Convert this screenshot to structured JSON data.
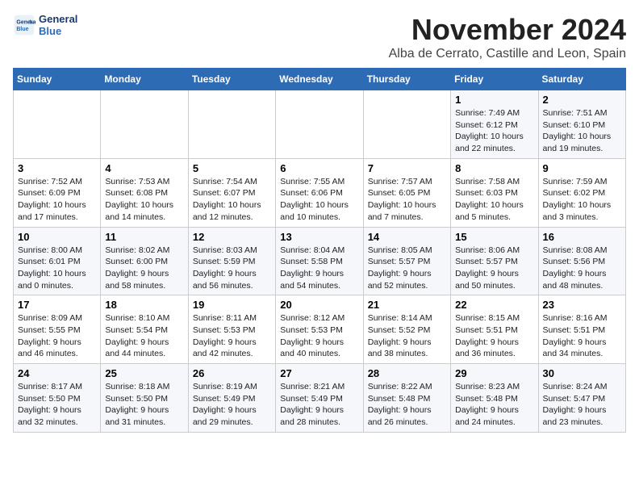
{
  "logo": {
    "line1": "General",
    "line2": "Blue"
  },
  "title": "November 2024",
  "location": "Alba de Cerrato, Castille and Leon, Spain",
  "weekdays": [
    "Sunday",
    "Monday",
    "Tuesday",
    "Wednesday",
    "Thursday",
    "Friday",
    "Saturday"
  ],
  "weeks": [
    [
      {
        "day": "",
        "text": ""
      },
      {
        "day": "",
        "text": ""
      },
      {
        "day": "",
        "text": ""
      },
      {
        "day": "",
        "text": ""
      },
      {
        "day": "",
        "text": ""
      },
      {
        "day": "1",
        "text": "Sunrise: 7:49 AM\nSunset: 6:12 PM\nDaylight: 10 hours and 22 minutes."
      },
      {
        "day": "2",
        "text": "Sunrise: 7:51 AM\nSunset: 6:10 PM\nDaylight: 10 hours and 19 minutes."
      }
    ],
    [
      {
        "day": "3",
        "text": "Sunrise: 7:52 AM\nSunset: 6:09 PM\nDaylight: 10 hours and 17 minutes."
      },
      {
        "day": "4",
        "text": "Sunrise: 7:53 AM\nSunset: 6:08 PM\nDaylight: 10 hours and 14 minutes."
      },
      {
        "day": "5",
        "text": "Sunrise: 7:54 AM\nSunset: 6:07 PM\nDaylight: 10 hours and 12 minutes."
      },
      {
        "day": "6",
        "text": "Sunrise: 7:55 AM\nSunset: 6:06 PM\nDaylight: 10 hours and 10 minutes."
      },
      {
        "day": "7",
        "text": "Sunrise: 7:57 AM\nSunset: 6:05 PM\nDaylight: 10 hours and 7 minutes."
      },
      {
        "day": "8",
        "text": "Sunrise: 7:58 AM\nSunset: 6:03 PM\nDaylight: 10 hours and 5 minutes."
      },
      {
        "day": "9",
        "text": "Sunrise: 7:59 AM\nSunset: 6:02 PM\nDaylight: 10 hours and 3 minutes."
      }
    ],
    [
      {
        "day": "10",
        "text": "Sunrise: 8:00 AM\nSunset: 6:01 PM\nDaylight: 10 hours and 0 minutes."
      },
      {
        "day": "11",
        "text": "Sunrise: 8:02 AM\nSunset: 6:00 PM\nDaylight: 9 hours and 58 minutes."
      },
      {
        "day": "12",
        "text": "Sunrise: 8:03 AM\nSunset: 5:59 PM\nDaylight: 9 hours and 56 minutes."
      },
      {
        "day": "13",
        "text": "Sunrise: 8:04 AM\nSunset: 5:58 PM\nDaylight: 9 hours and 54 minutes."
      },
      {
        "day": "14",
        "text": "Sunrise: 8:05 AM\nSunset: 5:57 PM\nDaylight: 9 hours and 52 minutes."
      },
      {
        "day": "15",
        "text": "Sunrise: 8:06 AM\nSunset: 5:57 PM\nDaylight: 9 hours and 50 minutes."
      },
      {
        "day": "16",
        "text": "Sunrise: 8:08 AM\nSunset: 5:56 PM\nDaylight: 9 hours and 48 minutes."
      }
    ],
    [
      {
        "day": "17",
        "text": "Sunrise: 8:09 AM\nSunset: 5:55 PM\nDaylight: 9 hours and 46 minutes."
      },
      {
        "day": "18",
        "text": "Sunrise: 8:10 AM\nSunset: 5:54 PM\nDaylight: 9 hours and 44 minutes."
      },
      {
        "day": "19",
        "text": "Sunrise: 8:11 AM\nSunset: 5:53 PM\nDaylight: 9 hours and 42 minutes."
      },
      {
        "day": "20",
        "text": "Sunrise: 8:12 AM\nSunset: 5:53 PM\nDaylight: 9 hours and 40 minutes."
      },
      {
        "day": "21",
        "text": "Sunrise: 8:14 AM\nSunset: 5:52 PM\nDaylight: 9 hours and 38 minutes."
      },
      {
        "day": "22",
        "text": "Sunrise: 8:15 AM\nSunset: 5:51 PM\nDaylight: 9 hours and 36 minutes."
      },
      {
        "day": "23",
        "text": "Sunrise: 8:16 AM\nSunset: 5:51 PM\nDaylight: 9 hours and 34 minutes."
      }
    ],
    [
      {
        "day": "24",
        "text": "Sunrise: 8:17 AM\nSunset: 5:50 PM\nDaylight: 9 hours and 32 minutes."
      },
      {
        "day": "25",
        "text": "Sunrise: 8:18 AM\nSunset: 5:50 PM\nDaylight: 9 hours and 31 minutes."
      },
      {
        "day": "26",
        "text": "Sunrise: 8:19 AM\nSunset: 5:49 PM\nDaylight: 9 hours and 29 minutes."
      },
      {
        "day": "27",
        "text": "Sunrise: 8:21 AM\nSunset: 5:49 PM\nDaylight: 9 hours and 28 minutes."
      },
      {
        "day": "28",
        "text": "Sunrise: 8:22 AM\nSunset: 5:48 PM\nDaylight: 9 hours and 26 minutes."
      },
      {
        "day": "29",
        "text": "Sunrise: 8:23 AM\nSunset: 5:48 PM\nDaylight: 9 hours and 24 minutes."
      },
      {
        "day": "30",
        "text": "Sunrise: 8:24 AM\nSunset: 5:47 PM\nDaylight: 9 hours and 23 minutes."
      }
    ]
  ]
}
